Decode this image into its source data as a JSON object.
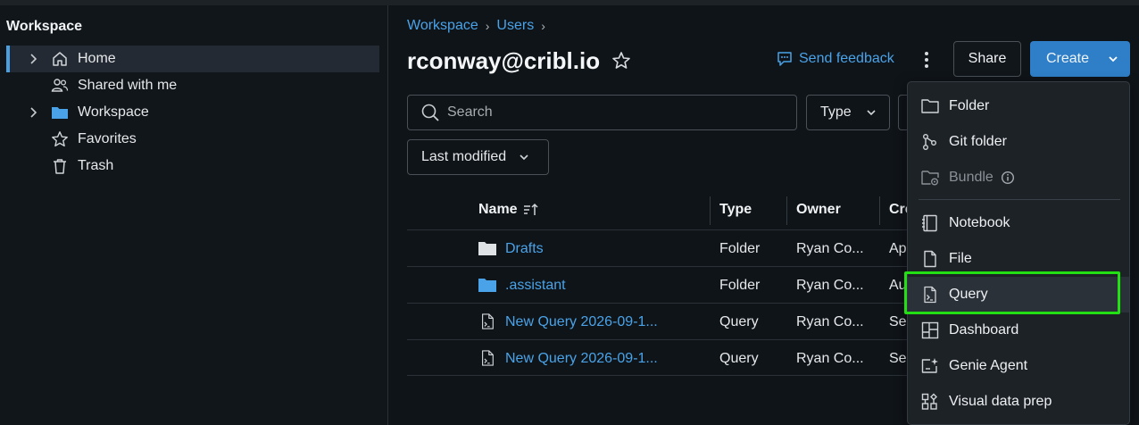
{
  "sidebar": {
    "title": "Workspace",
    "items": [
      {
        "label": "Home",
        "icon": "home-icon",
        "expandable": true,
        "active": true
      },
      {
        "label": "Shared with me",
        "icon": "users-icon",
        "expandable": false,
        "active": false
      },
      {
        "label": "Workspace",
        "icon": "folder-icon",
        "expandable": true,
        "active": false
      },
      {
        "label": "Favorites",
        "icon": "star-icon",
        "expandable": false,
        "active": false
      },
      {
        "label": "Trash",
        "icon": "trash-icon",
        "expandable": false,
        "active": false
      }
    ]
  },
  "breadcrumb": [
    "Workspace",
    "Users"
  ],
  "page": {
    "title": "rconway@cribl.io"
  },
  "header": {
    "feedback_label": "Send feedback",
    "share_label": "Share",
    "create_label": "Create"
  },
  "filters": {
    "search_placeholder": "Search",
    "type_label": "Type",
    "sort_label": "Last modified"
  },
  "table": {
    "columns": [
      "Name",
      "Type",
      "Owner",
      "Cre"
    ],
    "rows": [
      {
        "name": "Drafts",
        "type": "Folder",
        "owner": "Ryan Co...",
        "created": "Ap",
        "icon": "folder-icon"
      },
      {
        "name": ".assistant",
        "type": "Folder",
        "owner": "Ryan Co...",
        "created": "Au",
        "icon": "folder-icon"
      },
      {
        "name": "New Query 2026-09-1...",
        "type": "Query",
        "owner": "Ryan Co...",
        "created": "Se",
        "icon": "query-icon"
      },
      {
        "name": "New Query 2026-09-1...",
        "type": "Query",
        "owner": "Ryan Co...",
        "created": "Se",
        "icon": "query-icon"
      }
    ]
  },
  "create_menu": {
    "items": [
      {
        "label": "Folder",
        "icon": "folder-outline-icon",
        "disabled": false
      },
      {
        "label": "Git folder",
        "icon": "git-icon",
        "disabled": false
      },
      {
        "label": "Bundle",
        "icon": "bundle-icon",
        "disabled": true
      },
      {
        "label": "Notebook",
        "icon": "notebook-icon",
        "disabled": false
      },
      {
        "label": "File",
        "icon": "file-icon",
        "disabled": false
      },
      {
        "label": "Query",
        "icon": "query-icon",
        "disabled": false,
        "highlighted": true
      },
      {
        "label": "Dashboard",
        "icon": "dashboard-icon",
        "disabled": false
      },
      {
        "label": "Genie Agent",
        "icon": "genie-icon",
        "disabled": false
      },
      {
        "label": "Visual data prep",
        "icon": "data-prep-icon",
        "disabled": false
      }
    ]
  },
  "colors": {
    "accent": "#4aa3e8",
    "primary_button": "#2f7fc8",
    "highlight_box": "#22e014",
    "background": "#0f1419"
  }
}
